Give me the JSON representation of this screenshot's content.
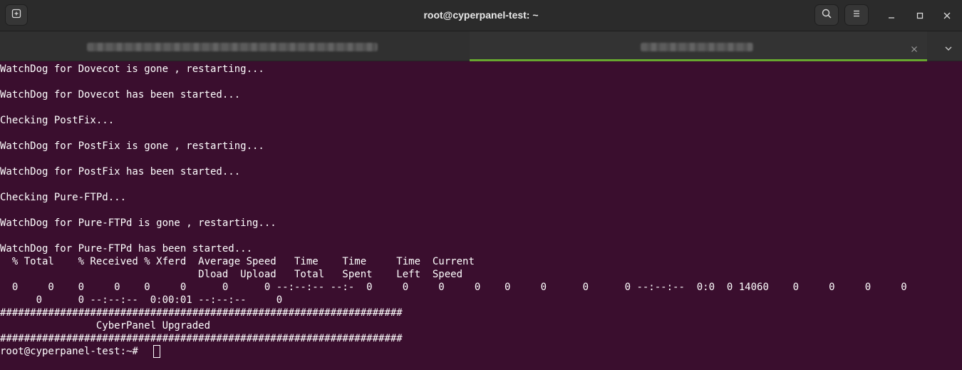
{
  "window": {
    "title": "root@cyperpanel-test: ~",
    "new_tab_icon": "new-tab-icon",
    "search_icon": "search-icon",
    "menu_icon": "hamburger-menu-icon",
    "minimize_icon": "minimize-icon",
    "maximize_icon": "maximize-icon",
    "close_icon": "close-icon"
  },
  "tabs": {
    "items": [
      {
        "label_obscured": true,
        "active": false
      },
      {
        "label_obscured": true,
        "active": true,
        "close_icon": "close-icon"
      }
    ],
    "dropdown_icon": "chevron-down-icon",
    "accent": "#67a72f"
  },
  "terminal": {
    "background": "#3a0e2e",
    "foreground": "#ffffff",
    "lines": [
      "WatchDog for Dovecot is gone , restarting...",
      "",
      "WatchDog for Dovecot has been started...",
      "",
      "Checking PostFix...",
      "",
      "WatchDog for PostFix is gone , restarting...",
      "",
      "WatchDog for PostFix has been started...",
      "",
      "Checking Pure-FTPd...",
      "",
      "WatchDog for Pure-FTPd is gone , restarting...",
      "",
      "WatchDog for Pure-FTPd has been started...",
      "  % Total    % Received % Xferd  Average Speed   Time    Time     Time  Current",
      "                                 Dload  Upload   Total   Spent    Left  Speed",
      "  0     0    0     0    0     0      0      0 --:--:-- --:-  0     0     0     0    0     0      0      0 --:--:--  0:0  0 14060    0     0     0     0",
      "      0      0 --:--:--  0:00:01 --:--:--     0",
      "###################################################################",
      "                CyberPanel Upgraded",
      "###################################################################",
      "root@cyperpanel-test:~# "
    ]
  }
}
